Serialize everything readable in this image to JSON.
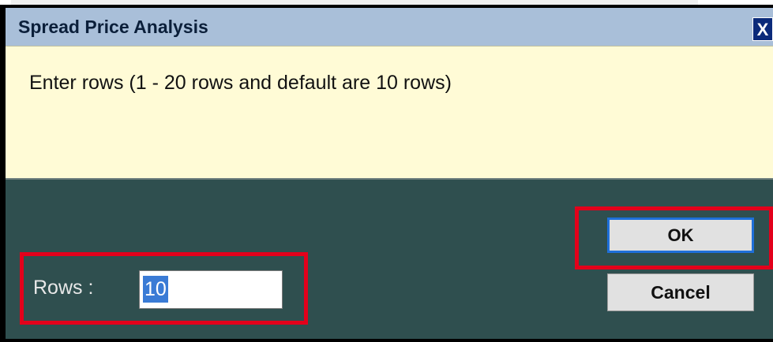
{
  "dialog": {
    "title": "Spread Price Analysis",
    "close_label": "X",
    "message": "Enter rows (1 - 20 rows and default are 10 rows)",
    "rows_label": "Rows :",
    "rows_value": "10",
    "ok_label": "OK",
    "cancel_label": "Cancel"
  },
  "colors": {
    "title_bar": "#a9bfd9",
    "message_bg": "#fffbd6",
    "panel_bg": "#2f4f4f",
    "highlight": "#e3001b",
    "ok_focus_border": "#1e6fd9"
  }
}
